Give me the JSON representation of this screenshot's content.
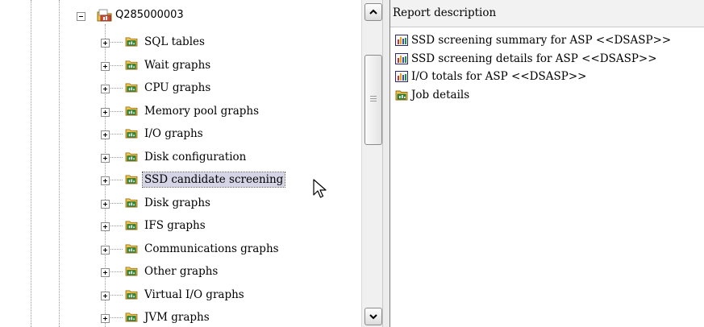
{
  "tree": {
    "root": {
      "label": "Q285000003",
      "icon": "report-folder-icon"
    },
    "items": [
      {
        "label": "SQL tables"
      },
      {
        "label": "Wait graphs"
      },
      {
        "label": "CPU graphs"
      },
      {
        "label": "Memory pool graphs"
      },
      {
        "label": "I/O graphs"
      },
      {
        "label": "Disk configuration"
      },
      {
        "label": "SSD candidate screening",
        "selected": true
      },
      {
        "label": "Disk graphs"
      },
      {
        "label": "IFS graphs"
      },
      {
        "label": "Communications graphs"
      },
      {
        "label": "Other graphs"
      },
      {
        "label": "Virtual I/O graphs"
      },
      {
        "label": "JVM graphs"
      }
    ]
  },
  "report_pane": {
    "header": "Report description",
    "items": [
      {
        "label": "SSD screening summary for ASP <<DSASP>>",
        "icon": "bar-chart-icon"
      },
      {
        "label": "SSD screening details for ASP <<DSASP>>",
        "icon": "bar-chart-icon"
      },
      {
        "label": "I/O totals for ASP <<DSASP>>",
        "icon": "bar-chart-icon"
      },
      {
        "label": "Job details",
        "icon": "folder-icon"
      }
    ]
  },
  "colors": {
    "selection_bg": "#d4d4e6",
    "folder_yellow": "#f2c34a",
    "folder_green": "#2e8b3e"
  }
}
